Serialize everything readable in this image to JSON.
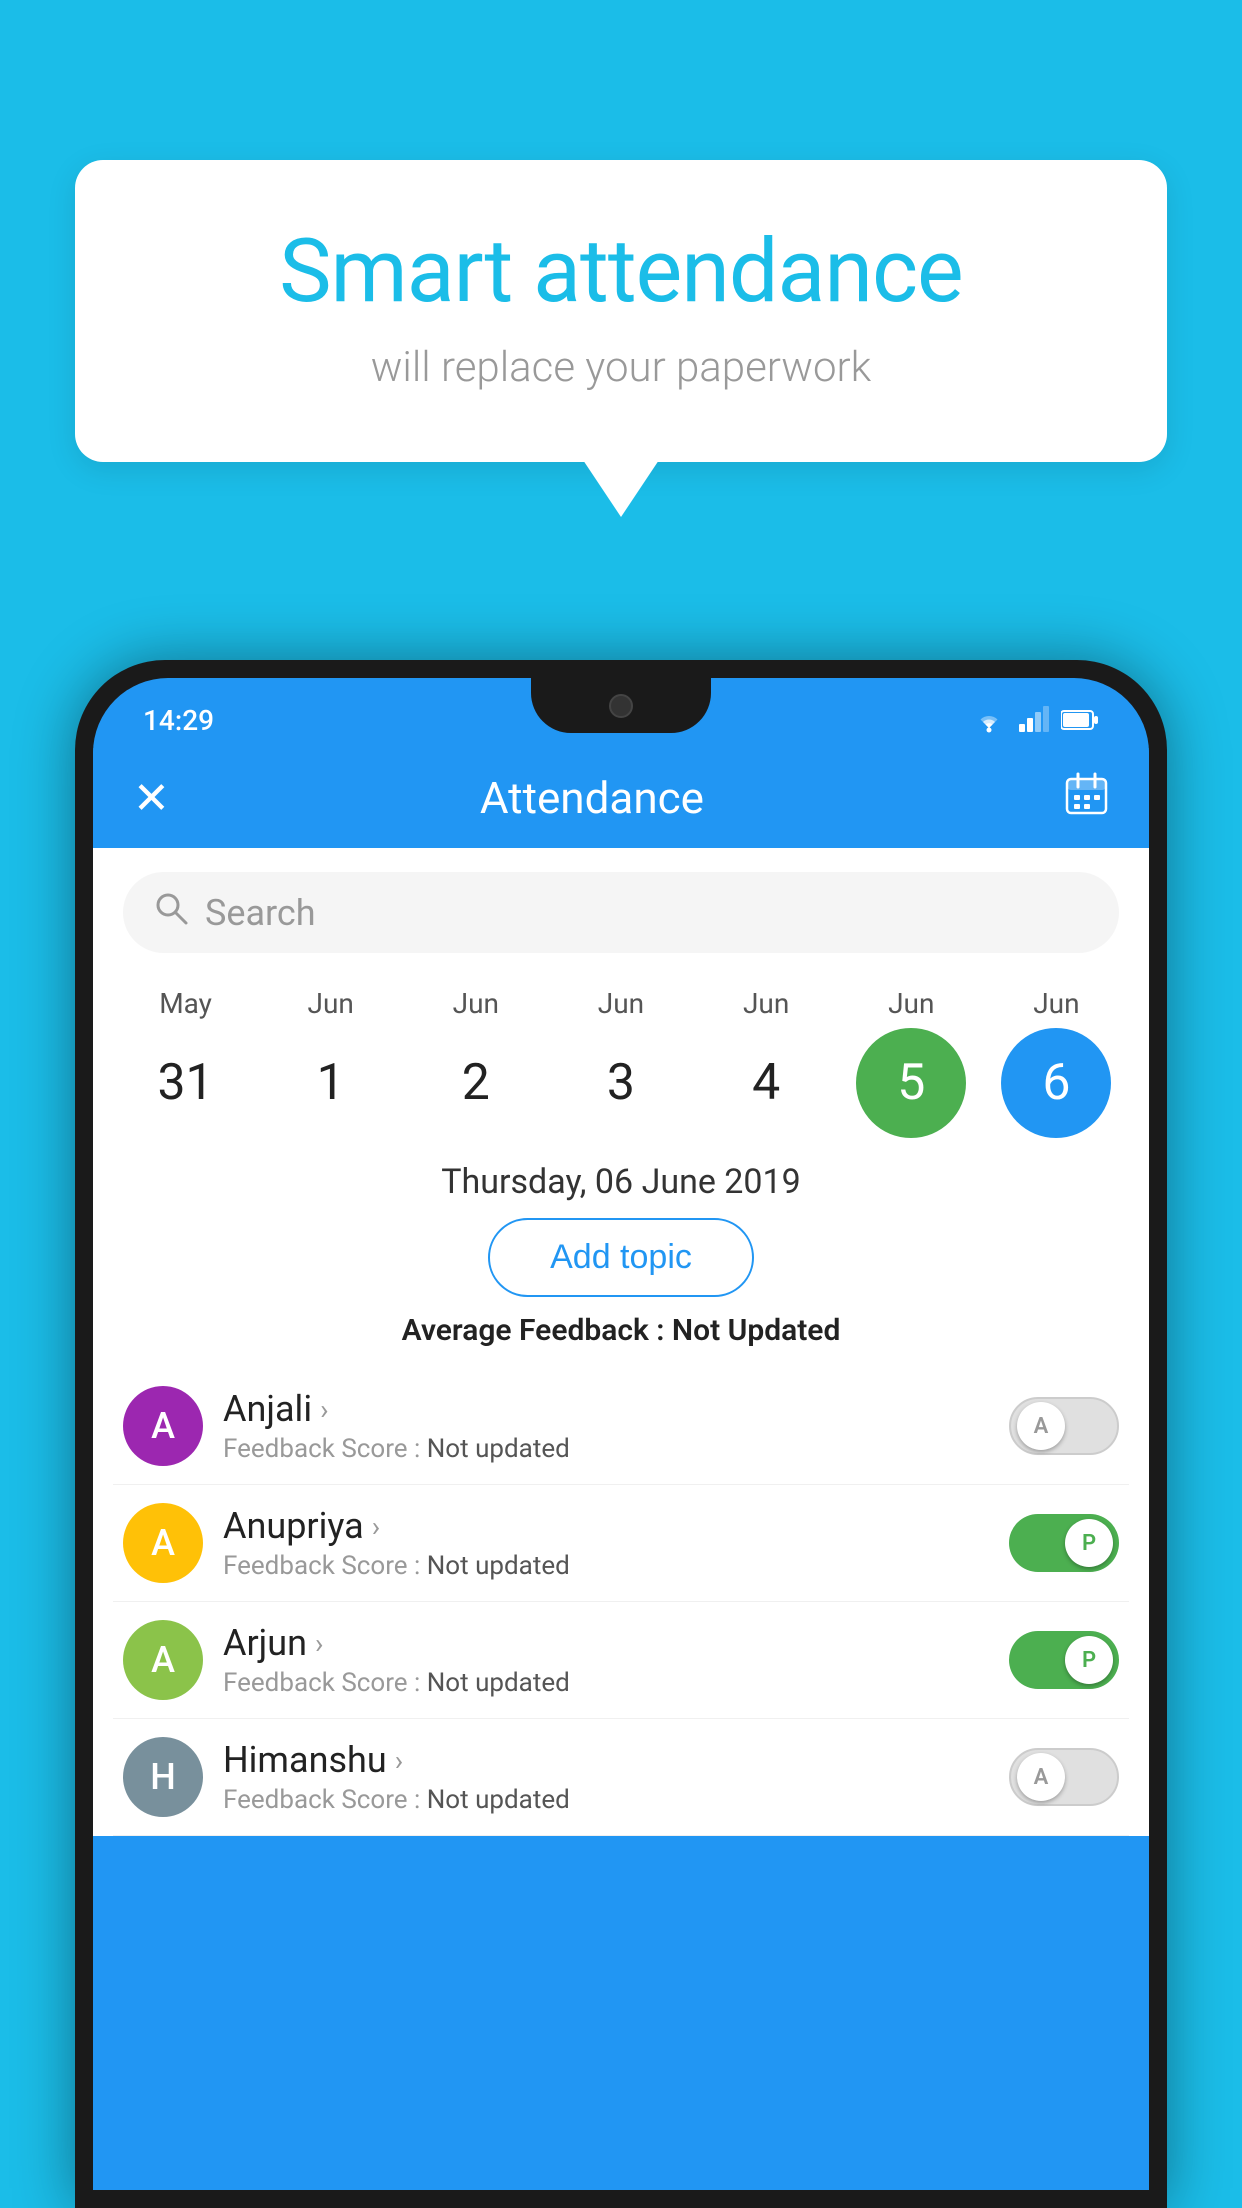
{
  "background_color": "#1BBDE8",
  "speech_bubble": {
    "title": "Smart attendance",
    "subtitle": "will replace your paperwork"
  },
  "status_bar": {
    "time": "14:29",
    "icons": [
      "wifi",
      "signal",
      "battery"
    ]
  },
  "app_bar": {
    "title": "Attendance",
    "close_label": "✕",
    "calendar_label": "📅"
  },
  "search": {
    "placeholder": "Search"
  },
  "date_strip": [
    {
      "month": "May",
      "day": "31",
      "state": "normal"
    },
    {
      "month": "Jun",
      "day": "1",
      "state": "normal"
    },
    {
      "month": "Jun",
      "day": "2",
      "state": "normal"
    },
    {
      "month": "Jun",
      "day": "3",
      "state": "normal"
    },
    {
      "month": "Jun",
      "day": "4",
      "state": "normal"
    },
    {
      "month": "Jun",
      "day": "5",
      "state": "today"
    },
    {
      "month": "Jun",
      "day": "6",
      "state": "selected"
    }
  ],
  "selected_date": "Thursday, 06 June 2019",
  "add_topic_label": "Add topic",
  "average_feedback": {
    "label": "Average Feedback :",
    "value": "Not Updated"
  },
  "students": [
    {
      "name": "Anjali",
      "avatar_letter": "A",
      "avatar_color": "purple",
      "feedback": "Feedback Score : Not updated",
      "toggle_state": "off",
      "toggle_letter": "A"
    },
    {
      "name": "Anupriya",
      "avatar_letter": "A",
      "avatar_color": "yellow",
      "feedback": "Feedback Score : Not updated",
      "toggle_state": "on",
      "toggle_letter": "P"
    },
    {
      "name": "Arjun",
      "avatar_letter": "A",
      "avatar_color": "light-green",
      "feedback": "Feedback Score : Not updated",
      "toggle_state": "on",
      "toggle_letter": "P"
    },
    {
      "name": "Himanshu",
      "avatar_letter": "H",
      "avatar_color": "green-gray",
      "feedback": "Feedback Score : Not updated",
      "toggle_state": "off",
      "toggle_letter": "A"
    }
  ]
}
